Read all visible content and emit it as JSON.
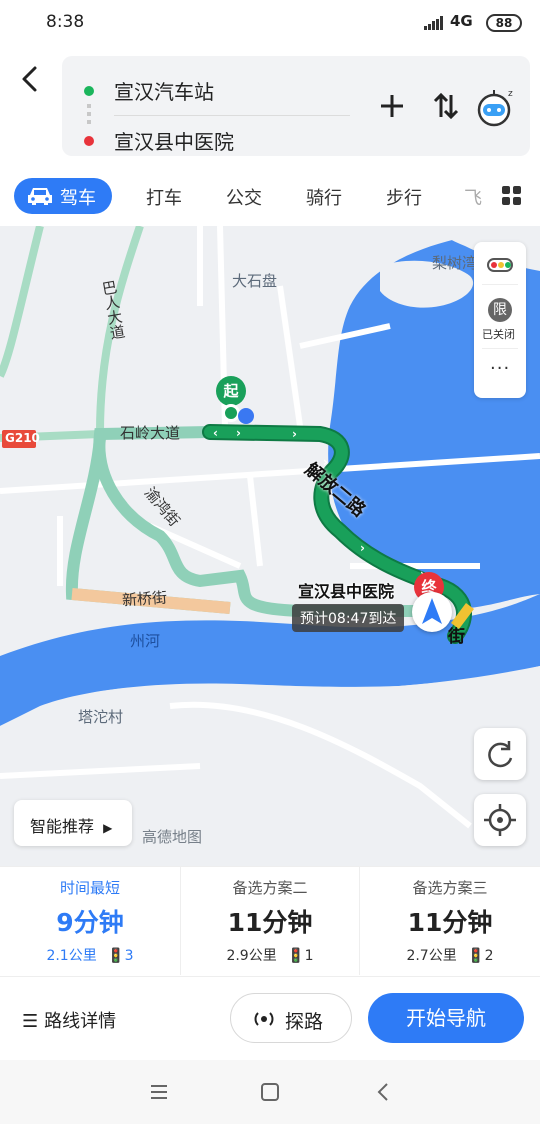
{
  "status": {
    "time": "8:38",
    "network": "4G",
    "battery": "88"
  },
  "header": {
    "origin": "宣汉汽车站",
    "destination": "宣汉县中医院"
  },
  "modes": {
    "active": "驾车",
    "tabs": [
      "打车",
      "公交",
      "骑行",
      "步行",
      "飞"
    ]
  },
  "map": {
    "places": [
      "大石盘",
      "梨树湾",
      "州河",
      "塔沱村"
    ],
    "roads": [
      "巴人大道",
      "石岭大道",
      "渝鸿街",
      "新桥街",
      "解放二路",
      "街"
    ],
    "highway": "G210",
    "start_marker": "起",
    "end_marker": "终",
    "controls": {
      "restriction": "限",
      "restriction_status": "已关闭"
    },
    "destination_label": "宣汉县中医院",
    "eta": "预计08:47到达",
    "smart_recommend": "智能推荐",
    "watermark": "高德地图",
    "colors": {
      "route_main": "#19a05a",
      "route_alt": "#8fd0b8",
      "water": "#4a8ff2",
      "congestion": "#f3c89d"
    }
  },
  "routes": [
    {
      "tag": "时间最短",
      "time": "9分钟",
      "distance": "2.1公里",
      "lights": "3",
      "active": true
    },
    {
      "tag": "备选方案二",
      "time": "11分钟",
      "distance": "2.9公里",
      "lights": "1",
      "active": false
    },
    {
      "tag": "备选方案三",
      "time": "11分钟",
      "distance": "2.7公里",
      "lights": "2",
      "active": false
    }
  ],
  "actions": {
    "details": "路线详情",
    "explore": "探路",
    "start": "开始导航"
  }
}
